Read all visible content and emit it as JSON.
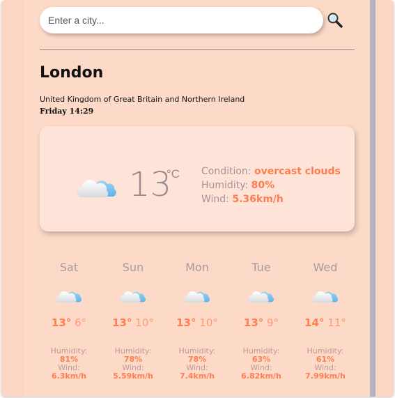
{
  "search": {
    "placeholder": "Enter a city...",
    "icon": "search-icon"
  },
  "current": {
    "city": "London",
    "country": "United Kingdom of Great Britain and Northern Ireland",
    "datetime": "Friday 14:29",
    "temperature": "13",
    "unit": "°C",
    "icon": "cloud-icon",
    "condition_label": "Condition:",
    "condition": "overcast clouds",
    "humidity_label": "Humidity:",
    "humidity": "80%",
    "wind_label": "Wind:",
    "wind": "5.36km/h"
  },
  "forecast": [
    {
      "day": "Sat",
      "high": "13°",
      "low": "6°",
      "humidity_label": "Humidity:",
      "humidity": "81%",
      "wind_label": "Wind:",
      "wind": "6.3km/h"
    },
    {
      "day": "Sun",
      "high": "13°",
      "low": "10°",
      "humidity_label": "Humidity:",
      "humidity": "78%",
      "wind_label": "Wind:",
      "wind": "5.59km/h"
    },
    {
      "day": "Mon",
      "high": "13°",
      "low": "10°",
      "humidity_label": "Humidity:",
      "humidity": "78%",
      "wind_label": "Wind:",
      "wind": "7.4km/h"
    },
    {
      "day": "Tue",
      "high": "13°",
      "low": "9°",
      "humidity_label": "Humidity:",
      "humidity": "63%",
      "wind_label": "Wind:",
      "wind": "6.82km/h"
    },
    {
      "day": "Wed",
      "high": "14°",
      "low": "11°",
      "humidity_label": "Humidity:",
      "humidity": "61%",
      "wind_label": "Wind:",
      "wind": "7.99km/h"
    }
  ],
  "colors": {
    "background": "#fdd9c7",
    "accent": "#ff7e4f",
    "card": "#fde3d8"
  }
}
